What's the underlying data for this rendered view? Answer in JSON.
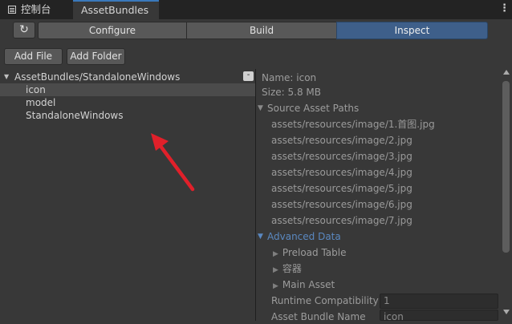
{
  "tabs": [
    {
      "label": "控制台"
    },
    {
      "label": "AssetBundles"
    }
  ],
  "window_menu_glyph": "⋮",
  "toolbar": {
    "refresh_glyph": "↻",
    "configure": "Configure",
    "build": "Build",
    "inspect": "Inspect",
    "add_file": "Add File",
    "add_folder": "Add Folder"
  },
  "tree": {
    "root": "AssetBundles/StandaloneWindows",
    "remove_glyph": "-",
    "items": [
      "icon",
      "model",
      "StandaloneWindows"
    ]
  },
  "inspector": {
    "name": "Name: icon",
    "size": "Size: 5.8 MB",
    "source_header": "Source Asset Paths",
    "paths": [
      "assets/resources/image/1.首图.jpg",
      "assets/resources/image/2.jpg",
      "assets/resources/image/3.jpg",
      "assets/resources/image/4.jpg",
      "assets/resources/image/5.jpg",
      "assets/resources/image/6.jpg",
      "assets/resources/image/7.jpg"
    ],
    "advanced_header": "Advanced Data",
    "sections": [
      "Preload Table",
      "容器",
      "Main Asset"
    ],
    "runtime_label": "Runtime Compatibility",
    "runtime_value": "1",
    "bundle_name_label": "Asset Bundle Name",
    "bundle_name_value": "icon"
  },
  "colors": {
    "background": "#383838",
    "accent": "#3e5f8a",
    "annotation_arrow": "#e0202a"
  }
}
